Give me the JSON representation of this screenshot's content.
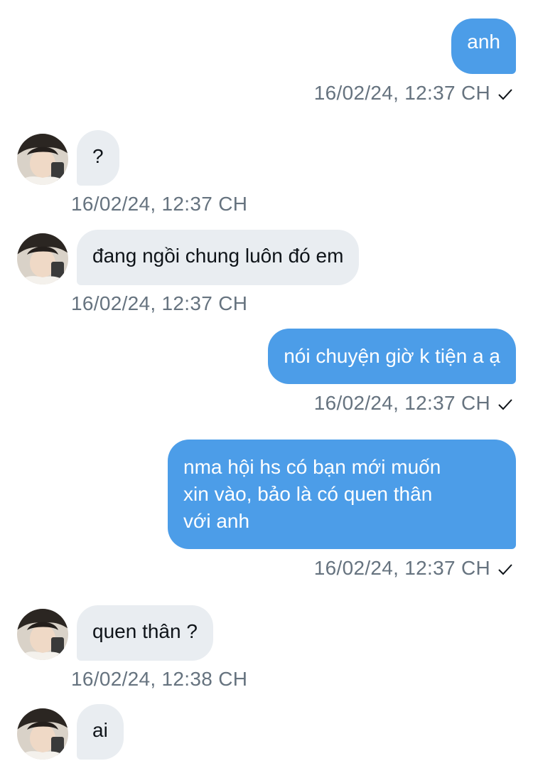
{
  "messages": [
    {
      "side": "sent",
      "text": "anh",
      "timestamp": "16/02/24, 12:37 CH",
      "read_icon": "check-icon"
    },
    {
      "side": "received",
      "text": "?",
      "timestamp": "16/02/24, 12:37 CH"
    },
    {
      "side": "received",
      "text": "đang ngồi chung luôn đó em",
      "timestamp": "16/02/24, 12:37 CH"
    },
    {
      "side": "sent",
      "text": "nói chuyện giờ k tiện a ạ",
      "timestamp": "16/02/24, 12:37 CH",
      "read_icon": "check-icon"
    },
    {
      "side": "sent",
      "text_lines": [
        "nma hội hs có bạn mới muốn",
        "xin vào, bảo là có quen thân",
        "với anh"
      ],
      "timestamp": "16/02/24, 12:37 CH",
      "read_icon": "check-icon"
    },
    {
      "side": "received",
      "text": "quen thân ?",
      "timestamp": "16/02/24, 12:38 CH"
    },
    {
      "side": "received",
      "text": "ai"
    }
  ],
  "colors": {
    "sent_bubble": "#4c9de8",
    "received_bubble": "#e9edf1",
    "timestamp_text": "#66737f"
  }
}
